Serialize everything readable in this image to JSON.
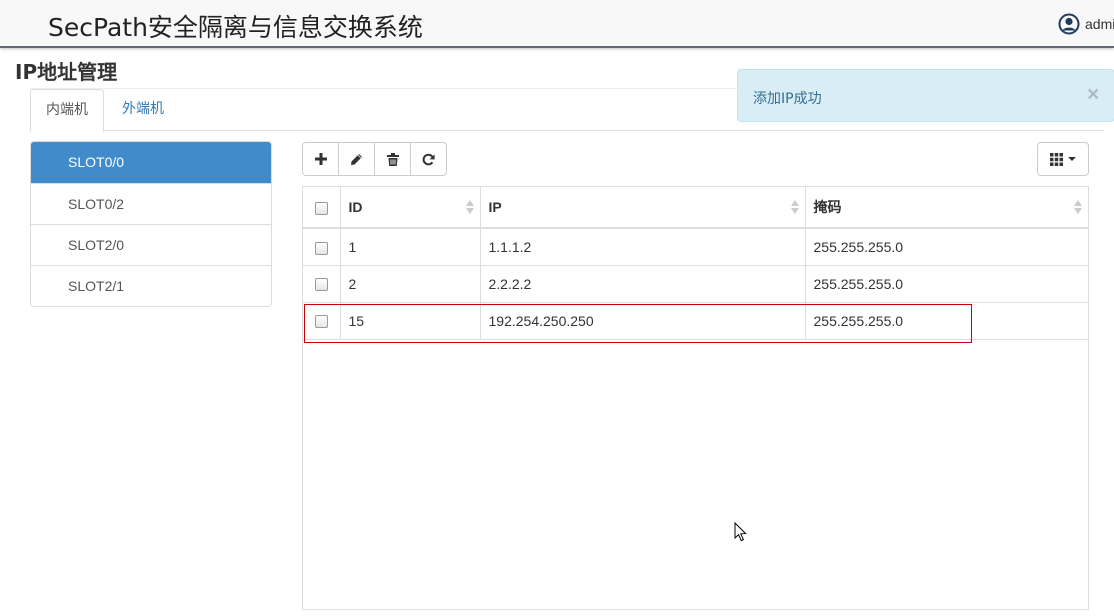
{
  "header": {
    "app_title": "SecPath安全隔离与信息交换系统",
    "user": "admin",
    "user_icon": "user-circle-icon"
  },
  "page": {
    "title": "IP地址管理"
  },
  "tabs": [
    {
      "label": "内端机",
      "active": true
    },
    {
      "label": "外端机",
      "active": false
    }
  ],
  "alert": {
    "message": "添加IP成功",
    "close": "×"
  },
  "slots": [
    {
      "label": "SLOT0/0",
      "active": true
    },
    {
      "label": "SLOT0/2"
    },
    {
      "label": "SLOT2/0"
    },
    {
      "label": "SLOT2/1"
    }
  ],
  "toolbar": {
    "icons": [
      "plus-icon",
      "pencil-icon",
      "trash-icon",
      "refresh-icon"
    ],
    "columns_icon": "grid-icon"
  },
  "table": {
    "columns": [
      "ID",
      "IP",
      "掩码"
    ],
    "rows": [
      {
        "id": "1",
        "ip": "1.1.1.2",
        "mask": "255.255.255.0"
      },
      {
        "id": "2",
        "ip": "2.2.2.2",
        "mask": "255.255.255.0"
      },
      {
        "id": "15",
        "ip": "192.254.250.250",
        "mask": "255.255.255.0"
      }
    ]
  },
  "colors": {
    "primary": "#428bca",
    "alert_bg": "#d9edf7",
    "alert_text": "#31708f",
    "highlight": "#cc0000",
    "header_border": "#5e6b78"
  }
}
